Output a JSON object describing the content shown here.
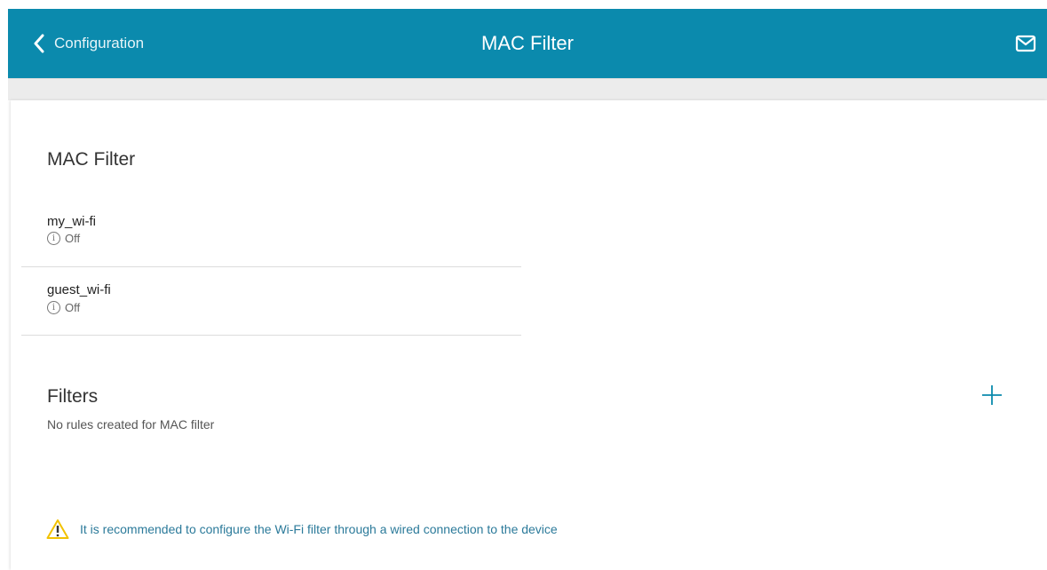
{
  "header": {
    "back_label": "Configuration",
    "title": "MAC Filter"
  },
  "mac_section": {
    "title": "MAC Filter",
    "networks": [
      {
        "name": "my_wi-fi",
        "status": "Off"
      },
      {
        "name": "guest_wi-fi",
        "status": "Off"
      }
    ]
  },
  "filters_section": {
    "title": "Filters",
    "empty_text": "No rules created for MAC filter"
  },
  "warning": {
    "text": "It is recommended to configure the Wi-Fi filter through a wired connection to the device"
  },
  "colors": {
    "header_bg": "#0b8aad",
    "warning_icon": "#f2c200",
    "warning_text": "#2b7a9a"
  }
}
